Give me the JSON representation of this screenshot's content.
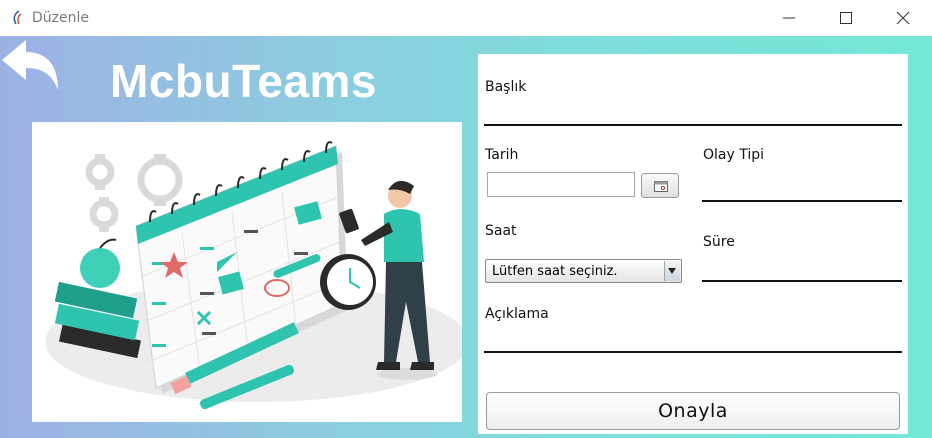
{
  "window": {
    "title": "Düzenle",
    "app_icon": "java-app-icon",
    "controls": [
      "minimize-icon",
      "maximize-icon",
      "close-icon"
    ]
  },
  "header": {
    "back_icon": "back-arrow-icon",
    "logo": "McbuTeams"
  },
  "illustration": {
    "subject": "calendar-planning-illustration"
  },
  "form": {
    "title_label": "Başlık",
    "title_value": "",
    "date_label": "Tarih",
    "date_value": "",
    "date_picker_icon": "calendar-picker-icon",
    "event_type_label": "Olay Tipi",
    "event_type_value": "",
    "time_label": "Saat",
    "time_select_value": "Lütfen saat seçiniz.",
    "duration_label": "Süre",
    "duration_value": "",
    "description_label": "Açıklama",
    "description_value": "",
    "confirm_label": "Onayla"
  },
  "colors": {
    "gradient_left": "#9db0e4",
    "gradient_right": "#74e8d6",
    "accent_teal": "#2ec4b0"
  }
}
